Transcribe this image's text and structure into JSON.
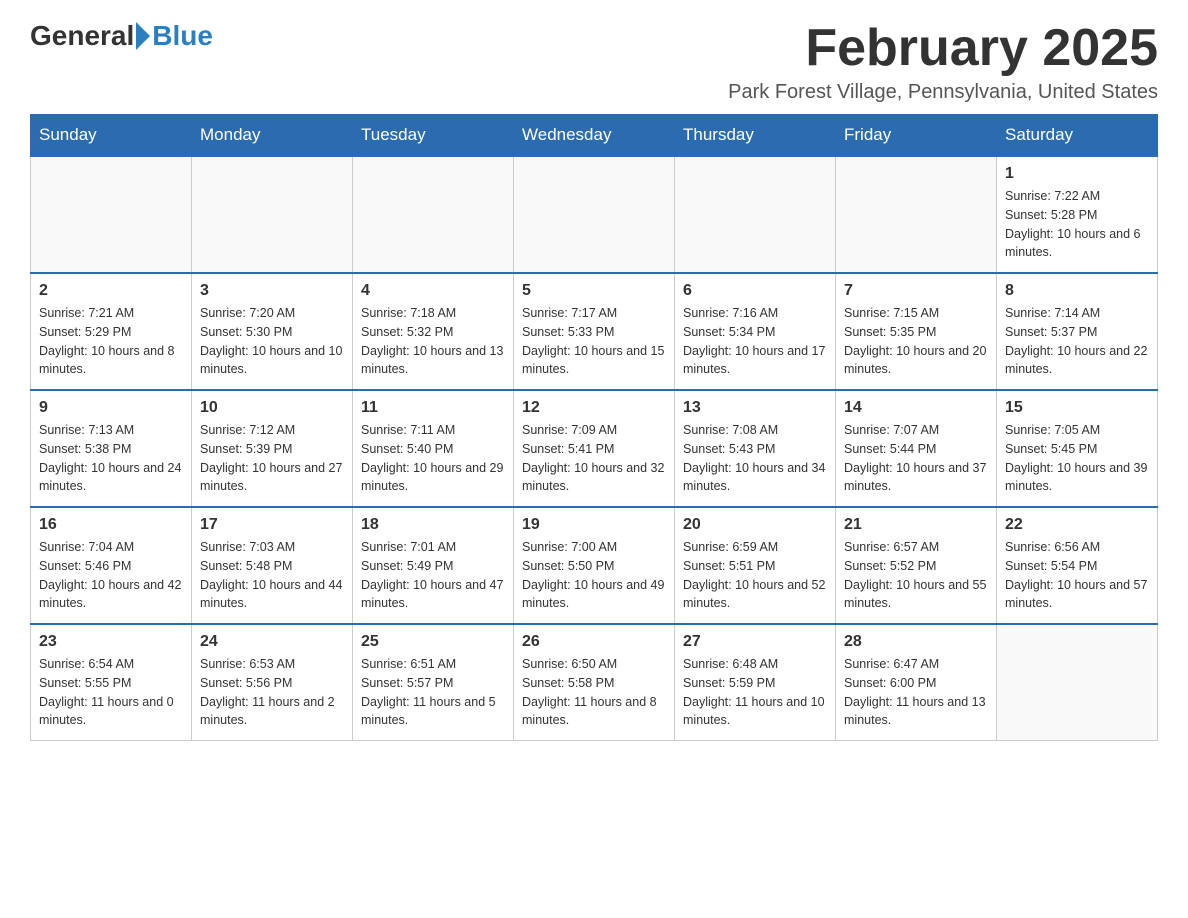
{
  "header": {
    "logo_general": "General",
    "logo_blue": "Blue",
    "month_title": "February 2025",
    "location": "Park Forest Village, Pennsylvania, United States"
  },
  "weekdays": [
    "Sunday",
    "Monday",
    "Tuesday",
    "Wednesday",
    "Thursday",
    "Friday",
    "Saturday"
  ],
  "weeks": [
    [
      {
        "day": "",
        "empty": true
      },
      {
        "day": "",
        "empty": true
      },
      {
        "day": "",
        "empty": true
      },
      {
        "day": "",
        "empty": true
      },
      {
        "day": "",
        "empty": true
      },
      {
        "day": "",
        "empty": true
      },
      {
        "day": "1",
        "sunrise": "7:22 AM",
        "sunset": "5:28 PM",
        "daylight": "10 hours and 6 minutes."
      }
    ],
    [
      {
        "day": "2",
        "sunrise": "7:21 AM",
        "sunset": "5:29 PM",
        "daylight": "10 hours and 8 minutes."
      },
      {
        "day": "3",
        "sunrise": "7:20 AM",
        "sunset": "5:30 PM",
        "daylight": "10 hours and 10 minutes."
      },
      {
        "day": "4",
        "sunrise": "7:18 AM",
        "sunset": "5:32 PM",
        "daylight": "10 hours and 13 minutes."
      },
      {
        "day": "5",
        "sunrise": "7:17 AM",
        "sunset": "5:33 PM",
        "daylight": "10 hours and 15 minutes."
      },
      {
        "day": "6",
        "sunrise": "7:16 AM",
        "sunset": "5:34 PM",
        "daylight": "10 hours and 17 minutes."
      },
      {
        "day": "7",
        "sunrise": "7:15 AM",
        "sunset": "5:35 PM",
        "daylight": "10 hours and 20 minutes."
      },
      {
        "day": "8",
        "sunrise": "7:14 AM",
        "sunset": "5:37 PM",
        "daylight": "10 hours and 22 minutes."
      }
    ],
    [
      {
        "day": "9",
        "sunrise": "7:13 AM",
        "sunset": "5:38 PM",
        "daylight": "10 hours and 24 minutes."
      },
      {
        "day": "10",
        "sunrise": "7:12 AM",
        "sunset": "5:39 PM",
        "daylight": "10 hours and 27 minutes."
      },
      {
        "day": "11",
        "sunrise": "7:11 AM",
        "sunset": "5:40 PM",
        "daylight": "10 hours and 29 minutes."
      },
      {
        "day": "12",
        "sunrise": "7:09 AM",
        "sunset": "5:41 PM",
        "daylight": "10 hours and 32 minutes."
      },
      {
        "day": "13",
        "sunrise": "7:08 AM",
        "sunset": "5:43 PM",
        "daylight": "10 hours and 34 minutes."
      },
      {
        "day": "14",
        "sunrise": "7:07 AM",
        "sunset": "5:44 PM",
        "daylight": "10 hours and 37 minutes."
      },
      {
        "day": "15",
        "sunrise": "7:05 AM",
        "sunset": "5:45 PM",
        "daylight": "10 hours and 39 minutes."
      }
    ],
    [
      {
        "day": "16",
        "sunrise": "7:04 AM",
        "sunset": "5:46 PM",
        "daylight": "10 hours and 42 minutes."
      },
      {
        "day": "17",
        "sunrise": "7:03 AM",
        "sunset": "5:48 PM",
        "daylight": "10 hours and 44 minutes."
      },
      {
        "day": "18",
        "sunrise": "7:01 AM",
        "sunset": "5:49 PM",
        "daylight": "10 hours and 47 minutes."
      },
      {
        "day": "19",
        "sunrise": "7:00 AM",
        "sunset": "5:50 PM",
        "daylight": "10 hours and 49 minutes."
      },
      {
        "day": "20",
        "sunrise": "6:59 AM",
        "sunset": "5:51 PM",
        "daylight": "10 hours and 52 minutes."
      },
      {
        "day": "21",
        "sunrise": "6:57 AM",
        "sunset": "5:52 PM",
        "daylight": "10 hours and 55 minutes."
      },
      {
        "day": "22",
        "sunrise": "6:56 AM",
        "sunset": "5:54 PM",
        "daylight": "10 hours and 57 minutes."
      }
    ],
    [
      {
        "day": "23",
        "sunrise": "6:54 AM",
        "sunset": "5:55 PM",
        "daylight": "11 hours and 0 minutes."
      },
      {
        "day": "24",
        "sunrise": "6:53 AM",
        "sunset": "5:56 PM",
        "daylight": "11 hours and 2 minutes."
      },
      {
        "day": "25",
        "sunrise": "6:51 AM",
        "sunset": "5:57 PM",
        "daylight": "11 hours and 5 minutes."
      },
      {
        "day": "26",
        "sunrise": "6:50 AM",
        "sunset": "5:58 PM",
        "daylight": "11 hours and 8 minutes."
      },
      {
        "day": "27",
        "sunrise": "6:48 AM",
        "sunset": "5:59 PM",
        "daylight": "11 hours and 10 minutes."
      },
      {
        "day": "28",
        "sunrise": "6:47 AM",
        "sunset": "6:00 PM",
        "daylight": "11 hours and 13 minutes."
      },
      {
        "day": "",
        "empty": true
      }
    ]
  ]
}
